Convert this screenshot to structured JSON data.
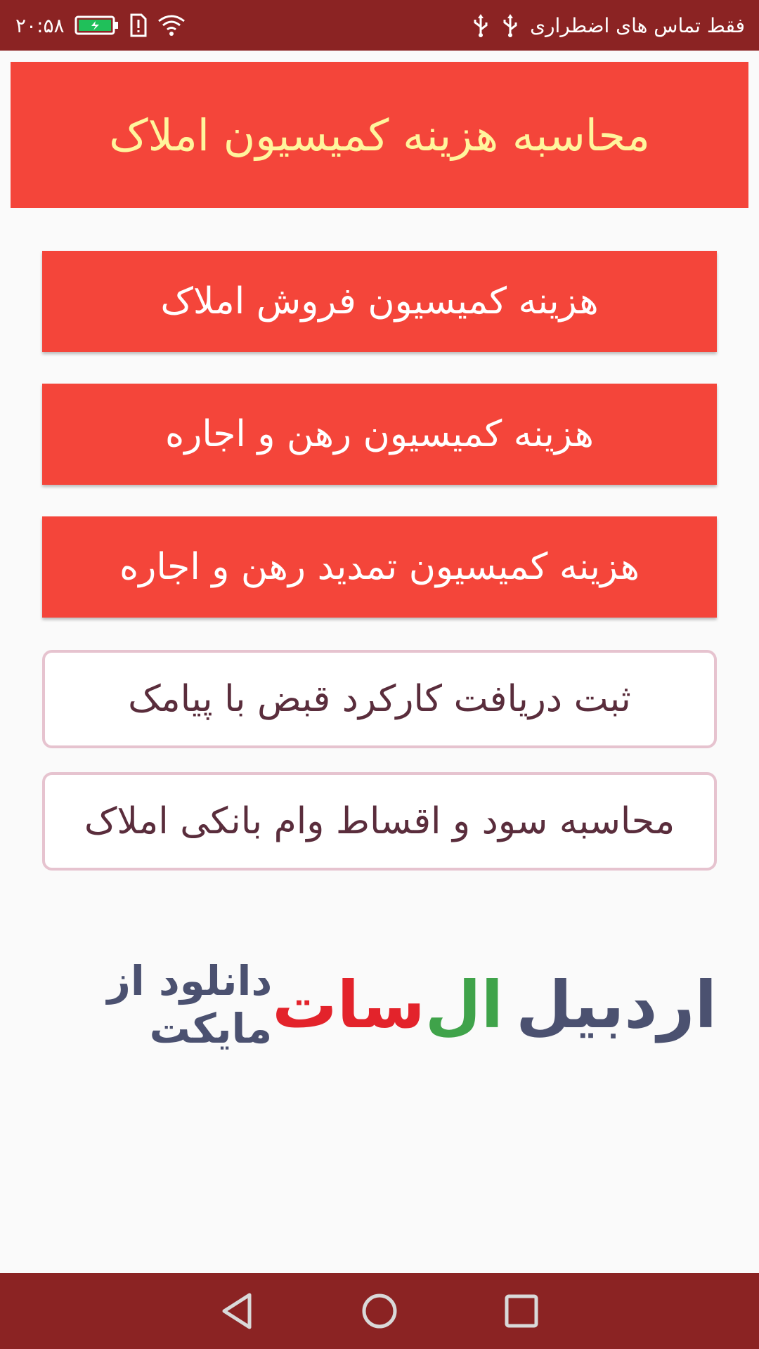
{
  "status_bar": {
    "time": "۲۰:۵۸",
    "carrier_text": "فقط تماس های اضطراری",
    "icons": [
      "battery-charging-icon",
      "sim-alert-icon",
      "wifi-icon",
      "usb-icon",
      "usb-icon"
    ]
  },
  "header": {
    "title": "محاسبه هزینه کمیسیون املاک"
  },
  "menu": {
    "buttons": [
      {
        "label": "هزینه کمیسیون فروش املاک"
      },
      {
        "label": "هزینه کمیسیون رهن و اجاره"
      },
      {
        "label": "هزینه کمیسیون تمدید رهن و اجاره"
      },
      {
        "label": "ثبت دریافت کارکرد قبض با پیامک"
      },
      {
        "label": "محاسبه سود و اقساط وام بانکی املاک"
      }
    ]
  },
  "ad": {
    "logo_part1": "اردبیل",
    "logo_part2": "ال",
    "logo_part3": "سات",
    "text": "دانلود از مایکت"
  },
  "nav": {
    "icons": [
      "back-icon",
      "home-icon",
      "recents-icon"
    ]
  },
  "colors": {
    "status_bar": "#8b2323",
    "primary": "#f4453a",
    "title_text": "#fff59d",
    "outline": "#e6c3cf",
    "outline_text": "#5a2d3c"
  }
}
